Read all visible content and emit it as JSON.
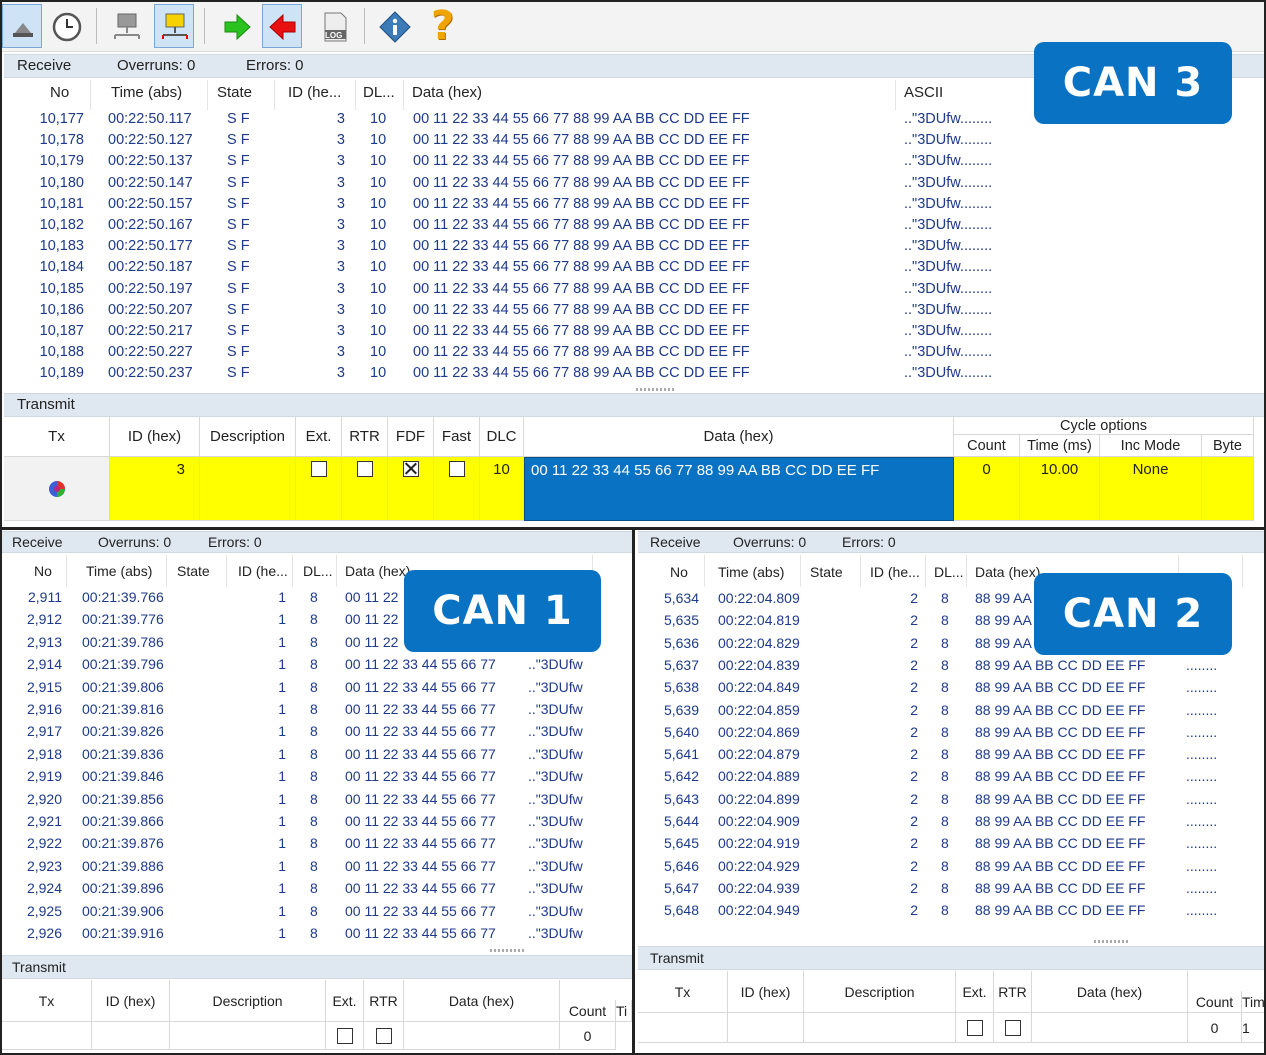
{
  "toolbar": {
    "icons": [
      "clear-icon",
      "clock-icon",
      "network-icon",
      "network-active-icon",
      "green-arrow-right-icon",
      "red-arrow-left-icon",
      "log-icon",
      "info-icon",
      "help-icon"
    ],
    "log_label": "LOG",
    "help_glyph": "?"
  },
  "badges": {
    "can3": "CAN 3",
    "can1": "CAN 1",
    "can2": "CAN 2"
  },
  "can3": {
    "receive": {
      "title": "Receive",
      "overruns": "Overruns: 0",
      "errors": "Errors: 0",
      "columns": [
        "No",
        "Time (abs)",
        "State",
        "ID (he...",
        "DL...",
        "Data (hex)",
        "ASCII"
      ],
      "rows": [
        [
          "10,177",
          "00:22:50.117",
          "S F",
          "3",
          "10",
          "00 11 22 33 44 55 66 77 88 99 AA BB CC DD EE FF",
          "..\"3DUfw........"
        ],
        [
          "10,178",
          "00:22:50.127",
          "S F",
          "3",
          "10",
          "00 11 22 33 44 55 66 77 88 99 AA BB CC DD EE FF",
          "..\"3DUfw........"
        ],
        [
          "10,179",
          "00:22:50.137",
          "S F",
          "3",
          "10",
          "00 11 22 33 44 55 66 77 88 99 AA BB CC DD EE FF",
          "..\"3DUfw........"
        ],
        [
          "10,180",
          "00:22:50.147",
          "S F",
          "3",
          "10",
          "00 11 22 33 44 55 66 77 88 99 AA BB CC DD EE FF",
          "..\"3DUfw........"
        ],
        [
          "10,181",
          "00:22:50.157",
          "S F",
          "3",
          "10",
          "00 11 22 33 44 55 66 77 88 99 AA BB CC DD EE FF",
          "..\"3DUfw........"
        ],
        [
          "10,182",
          "00:22:50.167",
          "S F",
          "3",
          "10",
          "00 11 22 33 44 55 66 77 88 99 AA BB CC DD EE FF",
          "..\"3DUfw........"
        ],
        [
          "10,183",
          "00:22:50.177",
          "S F",
          "3",
          "10",
          "00 11 22 33 44 55 66 77 88 99 AA BB CC DD EE FF",
          "..\"3DUfw........"
        ],
        [
          "10,184",
          "00:22:50.187",
          "S F",
          "3",
          "10",
          "00 11 22 33 44 55 66 77 88 99 AA BB CC DD EE FF",
          "..\"3DUfw........"
        ],
        [
          "10,185",
          "00:22:50.197",
          "S F",
          "3",
          "10",
          "00 11 22 33 44 55 66 77 88 99 AA BB CC DD EE FF",
          "..\"3DUfw........"
        ],
        [
          "10,186",
          "00:22:50.207",
          "S F",
          "3",
          "10",
          "00 11 22 33 44 55 66 77 88 99 AA BB CC DD EE FF",
          "..\"3DUfw........"
        ],
        [
          "10,187",
          "00:22:50.217",
          "S F",
          "3",
          "10",
          "00 11 22 33 44 55 66 77 88 99 AA BB CC DD EE FF",
          "..\"3DUfw........"
        ],
        [
          "10,188",
          "00:22:50.227",
          "S F",
          "3",
          "10",
          "00 11 22 33 44 55 66 77 88 99 AA BB CC DD EE FF",
          "..\"3DUfw........"
        ],
        [
          "10,189",
          "00:22:50.237",
          "S F",
          "3",
          "10",
          "00 11 22 33 44 55 66 77 88 99 AA BB CC DD EE FF",
          "..\"3DUfw........"
        ]
      ]
    },
    "transmit": {
      "title": "Transmit",
      "columns": {
        "tx": "Tx",
        "id": "ID (hex)",
        "description": "Description",
        "ext": "Ext.",
        "rtr": "RTR",
        "fdf": "FDF",
        "fast": "Fast",
        "dlc": "DLC",
        "data": "Data (hex)",
        "cycle": "Cycle options",
        "count": "Count",
        "time": "Time (ms)",
        "inc": "Inc Mode",
        "byte": "Byte"
      },
      "row": {
        "id": "3",
        "description": "",
        "ext": false,
        "rtr": false,
        "fdf": true,
        "fast": false,
        "dlc": "10",
        "data": "00 11 22 33 44 55 66 77 88 99 AA BB CC DD EE FF",
        "count": "0",
        "time": "10.00",
        "inc": "None",
        "byte": ""
      }
    }
  },
  "can1": {
    "receive": {
      "title": "Receive",
      "overruns": "Overruns: 0",
      "errors": "Errors: 0",
      "columns": [
        "No",
        "Time (abs)",
        "State",
        "ID (he...",
        "DL...",
        "Data (hex)"
      ],
      "rows": [
        [
          "2,911",
          "00:21:39.766",
          "1",
          "8",
          "00 11 22",
          ""
        ],
        [
          "2,912",
          "00:21:39.776",
          "1",
          "8",
          "00 11 22",
          ""
        ],
        [
          "2,913",
          "00:21:39.786",
          "1",
          "8",
          "00 11 22",
          ""
        ],
        [
          "2,914",
          "00:21:39.796",
          "1",
          "8",
          "00 11 22 33 44 55 66 77",
          "..\"3DUfw"
        ],
        [
          "2,915",
          "00:21:39.806",
          "1",
          "8",
          "00 11 22 33 44 55 66 77",
          "..\"3DUfw"
        ],
        [
          "2,916",
          "00:21:39.816",
          "1",
          "8",
          "00 11 22 33 44 55 66 77",
          "..\"3DUfw"
        ],
        [
          "2,917",
          "00:21:39.826",
          "1",
          "8",
          "00 11 22 33 44 55 66 77",
          "..\"3DUfw"
        ],
        [
          "2,918",
          "00:21:39.836",
          "1",
          "8",
          "00 11 22 33 44 55 66 77",
          "..\"3DUfw"
        ],
        [
          "2,919",
          "00:21:39.846",
          "1",
          "8",
          "00 11 22 33 44 55 66 77",
          "..\"3DUfw"
        ],
        [
          "2,920",
          "00:21:39.856",
          "1",
          "8",
          "00 11 22 33 44 55 66 77",
          "..\"3DUfw"
        ],
        [
          "2,921",
          "00:21:39.866",
          "1",
          "8",
          "00 11 22 33 44 55 66 77",
          "..\"3DUfw"
        ],
        [
          "2,922",
          "00:21:39.876",
          "1",
          "8",
          "00 11 22 33 44 55 66 77",
          "..\"3DUfw"
        ],
        [
          "2,923",
          "00:21:39.886",
          "1",
          "8",
          "00 11 22 33 44 55 66 77",
          "..\"3DUfw"
        ],
        [
          "2,924",
          "00:21:39.896",
          "1",
          "8",
          "00 11 22 33 44 55 66 77",
          "..\"3DUfw"
        ],
        [
          "2,925",
          "00:21:39.906",
          "1",
          "8",
          "00 11 22 33 44 55 66 77",
          "..\"3DUfw"
        ],
        [
          "2,926",
          "00:21:39.916",
          "1",
          "8",
          "00 11 22 33 44 55 66 77",
          "..\"3DUfw"
        ]
      ]
    },
    "transmit": {
      "title": "Transmit",
      "columns": {
        "tx": "Tx",
        "id": "ID (hex)",
        "description": "Description",
        "ext": "Ext.",
        "rtr": "RTR",
        "data": "Data (hex)",
        "count": "Count",
        "time_partial": "Ti"
      },
      "row": {
        "count": "0"
      }
    }
  },
  "can2": {
    "receive": {
      "title": "Receive",
      "overruns": "Overruns: 0",
      "errors": "Errors: 0",
      "columns": [
        "No",
        "Time (abs)",
        "State",
        "ID (he...",
        "DL...",
        "Data (hex)"
      ],
      "rows": [
        [
          "5,634",
          "00:22:04.809",
          "2",
          "8",
          "88 99 AA",
          ""
        ],
        [
          "5,635",
          "00:22:04.819",
          "2",
          "8",
          "88 99 AA",
          ""
        ],
        [
          "5,636",
          "00:22:04.829",
          "2",
          "8",
          "88 99 AA",
          ""
        ],
        [
          "5,637",
          "00:22:04.839",
          "2",
          "8",
          "88 99 AA BB CC DD EE FF",
          "........"
        ],
        [
          "5,638",
          "00:22:04.849",
          "2",
          "8",
          "88 99 AA BB CC DD EE FF",
          "........"
        ],
        [
          "5,639",
          "00:22:04.859",
          "2",
          "8",
          "88 99 AA BB CC DD EE FF",
          "........"
        ],
        [
          "5,640",
          "00:22:04.869",
          "2",
          "8",
          "88 99 AA BB CC DD EE FF",
          "........"
        ],
        [
          "5,641",
          "00:22:04.879",
          "2",
          "8",
          "88 99 AA BB CC DD EE FF",
          "........"
        ],
        [
          "5,642",
          "00:22:04.889",
          "2",
          "8",
          "88 99 AA BB CC DD EE FF",
          "........"
        ],
        [
          "5,643",
          "00:22:04.899",
          "2",
          "8",
          "88 99 AA BB CC DD EE FF",
          "........"
        ],
        [
          "5,644",
          "00:22:04.909",
          "2",
          "8",
          "88 99 AA BB CC DD EE FF",
          "........"
        ],
        [
          "5,645",
          "00:22:04.919",
          "2",
          "8",
          "88 99 AA BB CC DD EE FF",
          "........"
        ],
        [
          "5,646",
          "00:22:04.929",
          "2",
          "8",
          "88 99 AA BB CC DD EE FF",
          "........"
        ],
        [
          "5,647",
          "00:22:04.939",
          "2",
          "8",
          "88 99 AA BB CC DD EE FF",
          "........"
        ],
        [
          "5,648",
          "00:22:04.949",
          "2",
          "8",
          "88 99 AA BB CC DD EE FF",
          "........"
        ]
      ]
    },
    "transmit": {
      "title": "Transmit",
      "columns": {
        "tx": "Tx",
        "id": "ID (hex)",
        "description": "Description",
        "ext": "Ext.",
        "rtr": "RTR",
        "data": "Data (hex)",
        "count": "Count",
        "time_partial": "Tim"
      },
      "row": {
        "count": "0",
        "time_partial": "1"
      }
    }
  },
  "colors": {
    "selected_row": "#ffff00",
    "data_highlight": "#0a72c3",
    "badge": "#0a72c3",
    "bar": "#dfe7f1",
    "row_text": "#1e3a8a"
  }
}
